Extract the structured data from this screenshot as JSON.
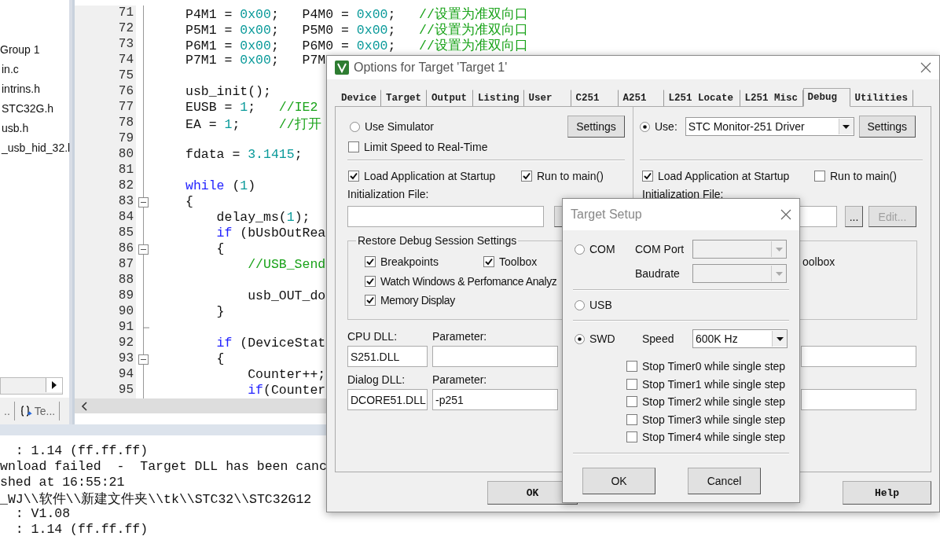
{
  "ide": {
    "project_tree": [
      {
        "label": "Group 1"
      },
      {
        "label": "in.c"
      },
      {
        "label": "intrins.h"
      },
      {
        "label": "STC32G.h"
      },
      {
        "label": "usb.h"
      },
      {
        "label": "_usb_hid_32.l"
      }
    ],
    "panel_tabs": [
      {
        "label": "..",
        "kind": "plain"
      },
      {
        "label": "Te...",
        "kind": "with-icon"
      }
    ],
    "code_lines": [
      {
        "number": "71",
        "segments": [
          {
            "text": "P4M1 = ",
            "kind": "plain"
          },
          {
            "text": "0x00",
            "kind": "number"
          },
          {
            "text": ";   P4M0 = ",
            "kind": "plain"
          },
          {
            "text": "0x00",
            "kind": "number"
          },
          {
            "text": ";   ",
            "kind": "plain"
          },
          {
            "text": "//设置为准双向口",
            "kind": "comment"
          }
        ]
      },
      {
        "number": "72",
        "segments": [
          {
            "text": "P5M1 = ",
            "kind": "plain"
          },
          {
            "text": "0x00",
            "kind": "number"
          },
          {
            "text": ";   P5M0 = ",
            "kind": "plain"
          },
          {
            "text": "0x00",
            "kind": "number"
          },
          {
            "text": ";   ",
            "kind": "plain"
          },
          {
            "text": "//设置为准双向口",
            "kind": "comment"
          }
        ]
      },
      {
        "number": "73",
        "segments": [
          {
            "text": "P6M1 = ",
            "kind": "plain"
          },
          {
            "text": "0x00",
            "kind": "number"
          },
          {
            "text": ";   P6M0 = ",
            "kind": "plain"
          },
          {
            "text": "0x00",
            "kind": "number"
          },
          {
            "text": ";   ",
            "kind": "plain"
          },
          {
            "text": "//设置为准双向口",
            "kind": "comment"
          }
        ]
      },
      {
        "number": "74",
        "segments": [
          {
            "text": "P7M1 = ",
            "kind": "plain"
          },
          {
            "text": "0x00",
            "kind": "number"
          },
          {
            "text": ";   P7M",
            "kind": "plain"
          }
        ]
      },
      {
        "number": "75",
        "kind": "plain"
      },
      {
        "number": "76",
        "segments": [
          {
            "text": "usb_init();",
            "kind": "plain"
          }
        ]
      },
      {
        "number": "77",
        "segments": [
          {
            "text": "EUSB = ",
            "kind": "plain"
          },
          {
            "text": "1",
            "kind": "number"
          },
          {
            "text": ";   ",
            "kind": "plain"
          },
          {
            "text": "//IE2",
            "kind": "comment"
          }
        ]
      },
      {
        "number": "78",
        "segments": [
          {
            "text": "EA = ",
            "kind": "plain"
          },
          {
            "text": "1",
            "kind": "number"
          },
          {
            "text": ";     ",
            "kind": "plain"
          },
          {
            "text": "//打开",
            "kind": "comment"
          }
        ]
      },
      {
        "number": "79",
        "kind": "plain"
      },
      {
        "number": "80",
        "segments": [
          {
            "text": "fdata = ",
            "kind": "plain"
          },
          {
            "text": "3.1415",
            "kind": "number"
          },
          {
            "text": ";",
            "kind": "plain"
          }
        ]
      },
      {
        "number": "81",
        "kind": "plain"
      },
      {
        "number": "82",
        "segments": [
          {
            "text": "while",
            "kind": "keyword"
          },
          {
            "text": " (",
            "kind": "plain"
          },
          {
            "text": "1",
            "kind": "number"
          },
          {
            "text": ")",
            "kind": "plain"
          }
        ]
      },
      {
        "number": "83",
        "kind": "fold-start",
        "segments": [
          {
            "text": "{",
            "kind": "plain"
          }
        ]
      },
      {
        "number": "84",
        "segments": [
          {
            "text": "    delay_ms(",
            "kind": "plain"
          },
          {
            "text": "1",
            "kind": "number"
          },
          {
            "text": ");",
            "kind": "plain"
          }
        ]
      },
      {
        "number": "85",
        "segments": [
          {
            "text": "    if",
            "kind": "keyword"
          },
          {
            "text": " (bUsbOutRea",
            "kind": "plain"
          }
        ]
      },
      {
        "number": "86",
        "kind": "fold-start",
        "segments": [
          {
            "text": "    {",
            "kind": "plain"
          }
        ]
      },
      {
        "number": "87",
        "segments": [
          {
            "text": "        //USB_Send",
            "kind": "comment"
          }
        ]
      },
      {
        "number": "88",
        "kind": "plain"
      },
      {
        "number": "89",
        "segments": [
          {
            "text": "        usb_OUT_do",
            "kind": "plain"
          }
        ]
      },
      {
        "number": "90",
        "segments": [
          {
            "text": "    }",
            "kind": "plain"
          }
        ]
      },
      {
        "number": "91",
        "kind": "fold-end"
      },
      {
        "number": "92",
        "segments": [
          {
            "text": "    if",
            "kind": "keyword"
          },
          {
            "text": " (DeviceStat",
            "kind": "plain"
          }
        ]
      },
      {
        "number": "93",
        "kind": "fold-start",
        "segments": [
          {
            "text": "    {",
            "kind": "plain"
          }
        ]
      },
      {
        "number": "94",
        "segments": [
          {
            "text": "        Counter++;",
            "kind": "plain"
          }
        ]
      },
      {
        "number": "95",
        "segments": [
          {
            "text": "        if",
            "kind": "keyword"
          },
          {
            "text": "(Counter",
            "kind": "plain"
          }
        ]
      }
    ],
    "output_lines": [
      "  : 1.14 (ff.ff.ff)",
      "wnload failed  -  Target DLL has been canc",
      "shed at 16:55:21",
      "_WJ\\\\软件\\\\新建文件夹\\\\tk\\\\STC32\\\\STC32G12",
      "  : V1.08",
      "  : 1.14 (ff.ff.ff)"
    ]
  },
  "options_dialog": {
    "title": "Options for Target 'Target 1'",
    "tabs": [
      {
        "label": "Device",
        "selected": false
      },
      {
        "label": "Target",
        "selected": false
      },
      {
        "label": "Output",
        "selected": false
      },
      {
        "label": "Listing",
        "selected": false
      },
      {
        "label": "User",
        "selected": false
      },
      {
        "label": "C251",
        "selected": false
      },
      {
        "label": "A251",
        "selected": false
      },
      {
        "label": "L251 Locate",
        "selected": false
      },
      {
        "label": "L251 Misc",
        "selected": false
      },
      {
        "label": "Debug",
        "selected": true
      },
      {
        "label": "Utilities",
        "selected": false
      }
    ],
    "left": {
      "simulator": {
        "label": "Use Simulator",
        "selected": false
      },
      "settings_button": "Settings",
      "limit_speed": {
        "label": "Limit Speed to Real-Time",
        "checked": false
      },
      "load_app": {
        "label": "Load Application at Startup",
        "checked": true
      },
      "run_to_main": {
        "label": "Run to main()",
        "checked": true
      },
      "init_label": "Initialization File:",
      "restore_group": {
        "title": "Restore Debug Session Settings",
        "items": [
          {
            "label": "Breakpoints",
            "checked": true
          },
          {
            "label": "Toolbox",
            "checked": true
          },
          {
            "label": "Watch Windows & Perfomance Analyz",
            "checked": true
          },
          {
            "label": "Memory Display",
            "checked": true
          }
        ]
      },
      "cpu_dll": {
        "label": "CPU DLL:",
        "value": "S251.DLL"
      },
      "cpu_param": {
        "label": "Parameter:"
      },
      "dialog_dll": {
        "label": "Dialog DLL:",
        "value": "DCORE51.DLL"
      },
      "dialog_param": {
        "label": "Parameter:",
        "value": "-p251"
      }
    },
    "right": {
      "driver": {
        "label": "Use:",
        "selected": true,
        "value": "STC Monitor-251 Driver"
      },
      "settings_button": "Settings",
      "load_app": {
        "label": "Load Application at Startup",
        "checked": true
      },
      "run_to_main": {
        "label": "Run to main()",
        "checked": false
      },
      "init_label": "Initialization File:",
      "browse_button": "...",
      "edit_button": {
        "label": "Edit...",
        "disabled": true
      },
      "toolbox_fragment": "oolbox"
    },
    "buttons": [
      "OK",
      "Help"
    ]
  },
  "target_setup": {
    "title": "Target Setup",
    "interfaces": [
      {
        "label": "COM",
        "selected": false
      },
      {
        "label": "USB",
        "selected": false
      },
      {
        "label": "SWD",
        "selected": true
      }
    ],
    "com_port": {
      "label": "COM Port",
      "disabled": true
    },
    "baudrate": {
      "label": "Baudrate",
      "disabled": true
    },
    "speed": {
      "label": "Speed",
      "value": "600K Hz"
    },
    "stop_timers": [
      {
        "label": "Stop Timer0 while single step",
        "checked": false
      },
      {
        "label": "Stop Timer1 while single step",
        "checked": false
      },
      {
        "label": "Stop Timer2 while single step",
        "checked": false
      },
      {
        "label": "Stop Timer3 while single step",
        "checked": false
      },
      {
        "label": "Stop Timer4 while single step",
        "checked": false
      }
    ],
    "buttons": [
      "OK",
      "Cancel"
    ]
  }
}
